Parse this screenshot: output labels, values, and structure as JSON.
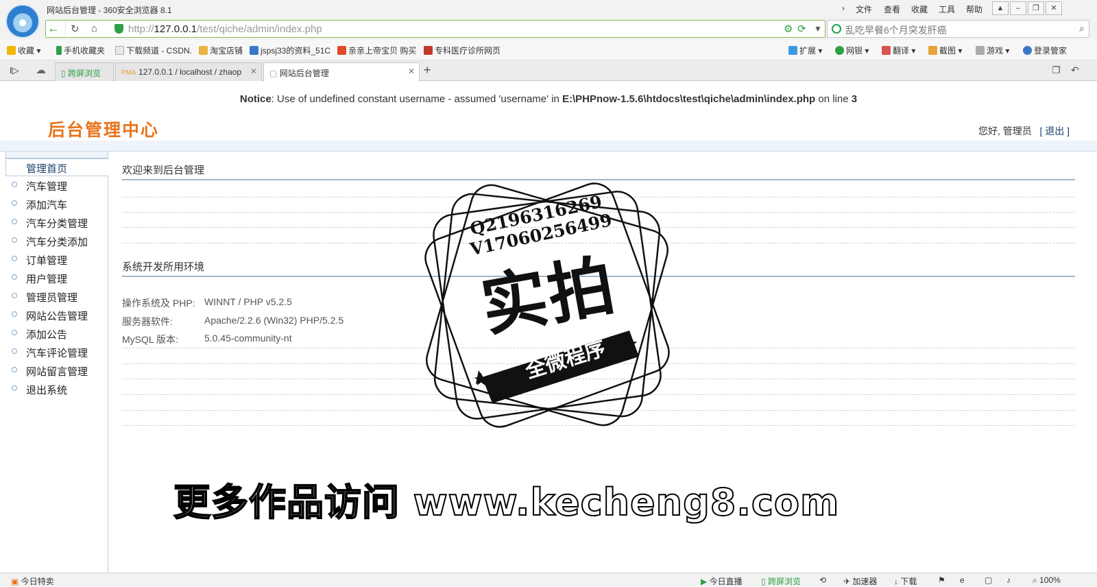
{
  "browser": {
    "window_title": "网站后台管理 - 360安全浏览器 8.1",
    "menus": [
      "文件",
      "查看",
      "收藏",
      "工具",
      "帮助"
    ],
    "window_buttons": [
      "gift-icon",
      "minimize-icon",
      "restore-icon",
      "close-icon"
    ],
    "address": {
      "prefix": "http://",
      "host": "127.0.0.1",
      "path": "/test/qiche/admin/index.php"
    },
    "search_placeholder": "乱吃早餐6个月突发肝癌",
    "bookmarks": [
      {
        "label": "收藏",
        "color": "#f2b705"
      },
      {
        "label": "手机收藏夹",
        "color": "#2ea043"
      },
      {
        "label": "下载频道 - CSDN.",
        "color": "#dddddd"
      },
      {
        "label": "淘宝店铺",
        "color": "#e8b341"
      },
      {
        "label": "jspsj33的资料_51C",
        "color": "#3c78c8"
      },
      {
        "label": "亲亲上帝宝贝 购买",
        "color": "#e04a2a"
      },
      {
        "label": "专科医疗诊所网页",
        "color": "#c0392b"
      }
    ],
    "toolbar_right": [
      "扩展",
      "网银",
      "翻译",
      "截图",
      "游戏",
      "登录管家"
    ],
    "tabs": [
      {
        "label": "跨屏浏览",
        "active": false
      },
      {
        "label": "127.0.0.1 / localhost / zhaop",
        "active": false
      },
      {
        "label": "网站后台管理",
        "active": true
      }
    ],
    "status_left": "今日特卖",
    "status_right": [
      "今日直播",
      "跨屏浏览",
      "加速器",
      "下载",
      "100%"
    ]
  },
  "notice": {
    "label": "Notice",
    "message": ": Use of undefined constant username - assumed 'username' in ",
    "file": "E:\\PHPnow-1.5.6\\htdocs\\test\\qiche\\admin\\index.php",
    "on_line": " on line ",
    "line": "3"
  },
  "header": {
    "brand": "后台管理中心",
    "greeting": "您好, 管理员",
    "logout": "[ 退出 ]"
  },
  "sidebar": {
    "items": [
      {
        "label": "管理首页",
        "active": true
      },
      {
        "label": "汽车管理"
      },
      {
        "label": "添加汽车"
      },
      {
        "label": "汽车分类管理"
      },
      {
        "label": "汽车分类添加"
      },
      {
        "label": "订单管理"
      },
      {
        "label": "用户管理"
      },
      {
        "label": "管理员管理"
      },
      {
        "label": "网站公告管理"
      },
      {
        "label": "添加公告"
      },
      {
        "label": "汽车评论管理"
      },
      {
        "label": "网站留言管理"
      },
      {
        "label": "退出系统"
      }
    ]
  },
  "main": {
    "welcome_title": "欢迎来到后台管理",
    "env_title": "系统开发所用环境",
    "env": [
      {
        "key": "操作系统及 PHP:",
        "value": "WINNT / PHP v5.2.5"
      },
      {
        "key": "服务器软件:",
        "value": "Apache/2.2.6 (Win32) PHP/5.2.5"
      },
      {
        "key": "MySQL 版本:",
        "value": "5.0.45-community-nt"
      }
    ]
  },
  "watermark": {
    "qq": "Q2196316269",
    "wechat": "V17060256499",
    "main": "实拍",
    "banner": "全微程序",
    "promo": "更多作品访问 www.kecheng8.com"
  }
}
